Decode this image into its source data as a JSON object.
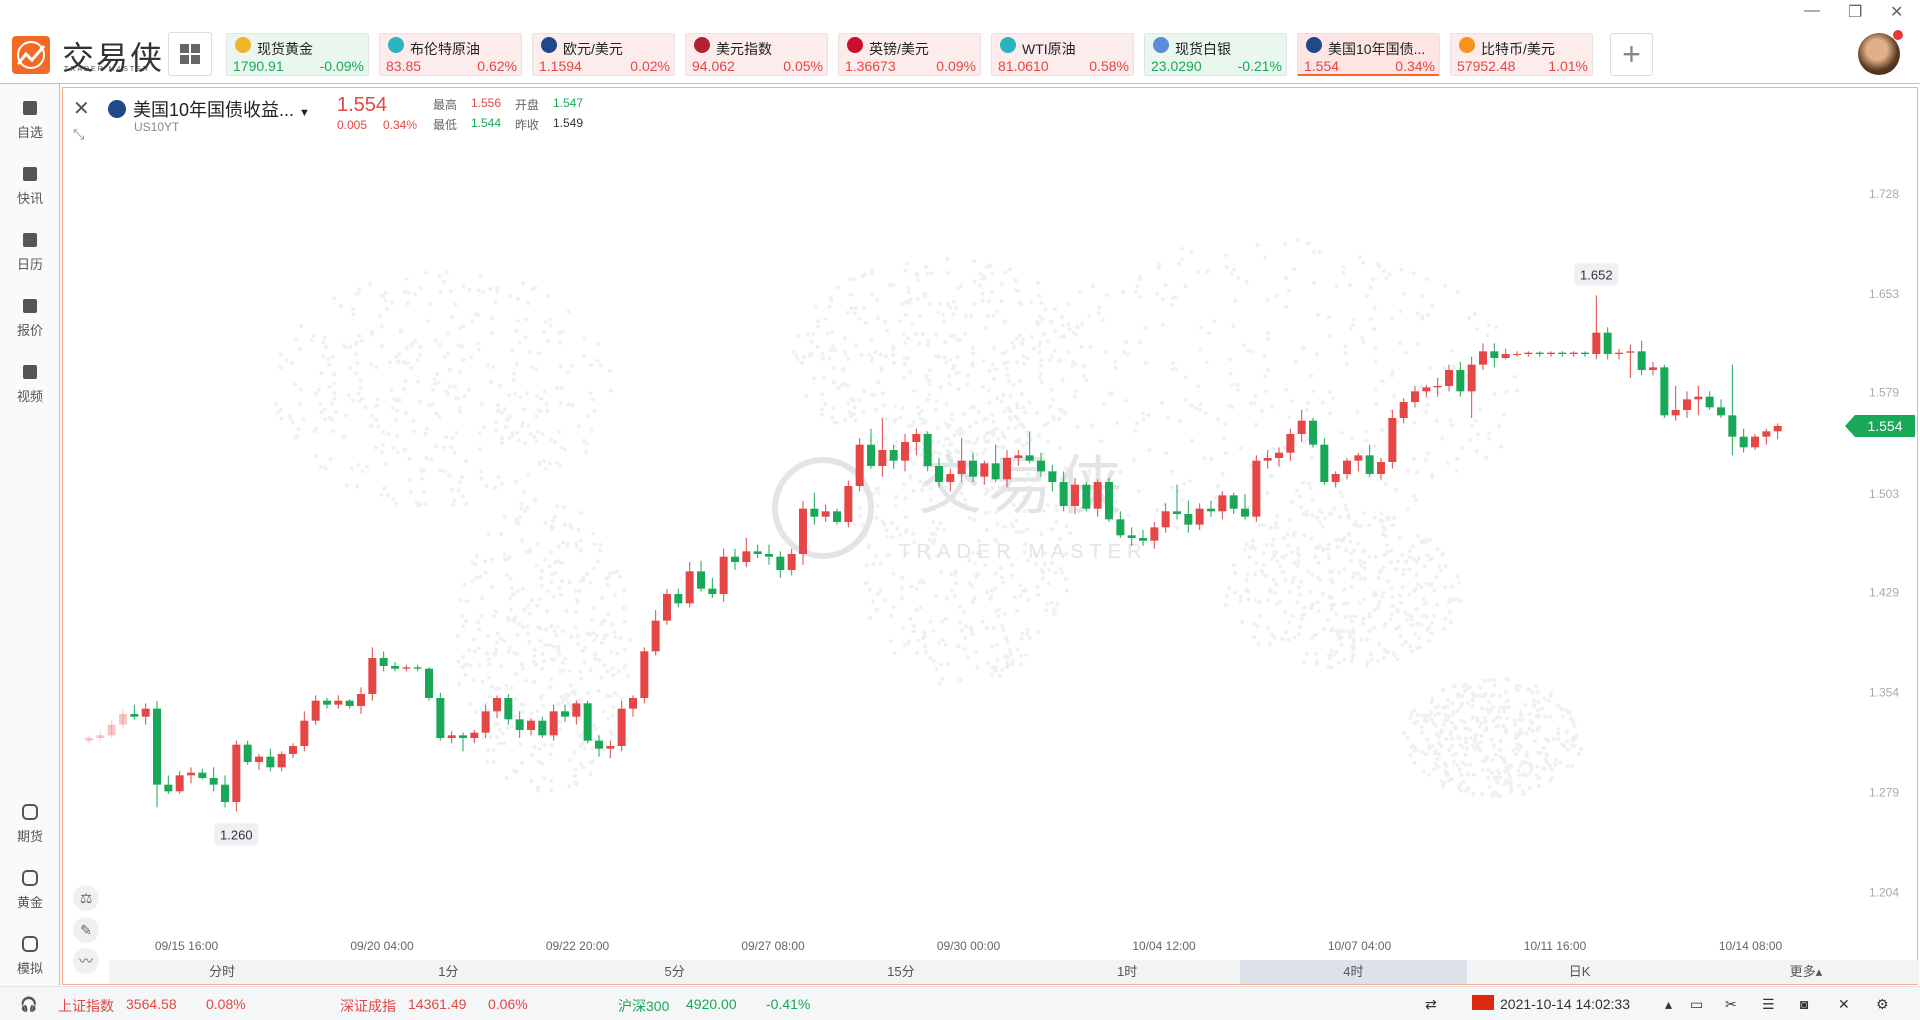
{
  "header": {
    "logo_text": "交易侠",
    "logo_sub": "TRADER MASTER",
    "tiles": [
      {
        "name": "现货黄金",
        "price": "1790.91",
        "pct": "-0.09%",
        "dir": "down",
        "icon_color": "#f0b429",
        "icon": "gold-icon"
      },
      {
        "name": "布伦特原油",
        "price": "83.85",
        "pct": "0.62%",
        "dir": "up",
        "icon_color": "#2bb3c0",
        "icon": "oil-icon"
      },
      {
        "name": "欧元/美元",
        "price": "1.1594",
        "pct": "0.02%",
        "dir": "up",
        "icon_color": "#1f4a8a",
        "icon": "eu-flag-icon"
      },
      {
        "name": "美元指数",
        "price": "94.062",
        "pct": "0.05%",
        "dir": "up",
        "icon_color": "#b22234",
        "icon": "us-flag-icon"
      },
      {
        "name": "英镑/美元",
        "price": "1.36673",
        "pct": "0.09%",
        "dir": "up",
        "icon_color": "#c8102e",
        "icon": "uk-flag-icon"
      },
      {
        "name": "WTI原油",
        "price": "81.0610",
        "pct": "0.58%",
        "dir": "up",
        "icon_color": "#2bb3c0",
        "icon": "oil-icon"
      },
      {
        "name": "现货白银",
        "price": "23.0290",
        "pct": "-0.21%",
        "dir": "down",
        "icon_color": "#5b8bd9",
        "icon": "silver-icon"
      },
      {
        "name": "美国10年国债...",
        "price": "1.554",
        "pct": "0.34%",
        "dir": "up",
        "icon_color": "#1f4a8a",
        "icon": "bond-icon",
        "active": true
      },
      {
        "name": "比特币/美元",
        "price": "57952.48",
        "pct": "1.01%",
        "dir": "up",
        "icon_color": "#f7931a",
        "icon": "bitcoin-icon"
      }
    ]
  },
  "sidebar": {
    "top": [
      {
        "label": "自选",
        "icon": "bookmark-plus-icon"
      },
      {
        "label": "快讯",
        "icon": "news-icon"
      },
      {
        "label": "日历",
        "icon": "calendar-icon"
      },
      {
        "label": "报价",
        "icon": "chart-line-icon"
      },
      {
        "label": "视频",
        "icon": "video-icon"
      }
    ],
    "bottom": [
      {
        "label": "期货",
        "icon": "futures-icon"
      },
      {
        "label": "黄金",
        "icon": "gold-bar-icon"
      },
      {
        "label": "模拟",
        "icon": "simulate-icon"
      }
    ]
  },
  "symbol": {
    "name": "美国10年国债收益...",
    "code": "US10YT",
    "price": "1.554",
    "change": "0.005",
    "pct": "0.34%",
    "high_label": "最高",
    "high": "1.556",
    "low_label": "最低",
    "low": "1.544",
    "open_label": "开盘",
    "open": "1.547",
    "prev_label": "昨收",
    "prev": "1.549"
  },
  "timeframes": [
    "分时",
    "1分",
    "5分",
    "15分",
    "1时",
    "4时",
    "日K",
    "更多▴"
  ],
  "active_timeframe": "4时",
  "statusbar": {
    "items": [
      {
        "name": "上证指数",
        "value": "3564.58",
        "pct": "0.08%",
        "dir": "up"
      },
      {
        "name": "深证成指",
        "value": "14361.49",
        "pct": "0.06%",
        "dir": "up"
      },
      {
        "name": "沪深300",
        "value": "4920.00",
        "pct": "-0.41%",
        "dir": "down"
      }
    ],
    "datetime": "2021-10-14 14:02:33"
  },
  "watermark": {
    "text": "交易侠",
    "sub": "TRADER MASTER"
  },
  "chart_data": {
    "type": "candlestick",
    "y_ticks": [
      1.204,
      1.279,
      1.354,
      1.429,
      1.503,
      1.579,
      1.653,
      1.728
    ],
    "ylim": [
      1.17,
      1.77
    ],
    "x_tick_labels": [
      "09/15 16:00",
      "09/20 04:00",
      "09/22 20:00",
      "09/27 08:00",
      "09/30 00:00",
      "10/04 12:00",
      "10/07 04:00",
      "10/11 16:00",
      "10/14 08:00"
    ],
    "current_price_label": "1.554",
    "max_label": "1.652",
    "min_label": "1.260",
    "candles": [
      [
        1.318,
        1.322,
        1.316,
        1.32
      ],
      [
        1.32,
        1.325,
        1.318,
        1.322
      ],
      [
        1.322,
        1.333,
        1.32,
        1.33
      ],
      [
        1.33,
        1.342,
        1.327,
        1.338
      ],
      [
        1.338,
        1.345,
        1.334,
        1.336
      ],
      [
        1.336,
        1.346,
        1.33,
        1.342
      ],
      [
        1.342,
        1.348,
        1.268,
        1.285
      ],
      [
        1.285,
        1.292,
        1.278,
        1.28
      ],
      [
        1.28,
        1.295,
        1.278,
        1.292
      ],
      [
        1.292,
        1.298,
        1.286,
        1.294
      ],
      [
        1.294,
        1.297,
        1.289,
        1.29
      ],
      [
        1.29,
        1.298,
        1.28,
        1.285
      ],
      [
        1.285,
        1.292,
        1.268,
        1.272
      ],
      [
        1.272,
        1.318,
        1.265,
        1.315
      ],
      [
        1.315,
        1.318,
        1.3,
        1.302
      ],
      [
        1.302,
        1.308,
        1.296,
        1.306
      ],
      [
        1.306,
        1.312,
        1.295,
        1.298
      ],
      [
        1.298,
        1.31,
        1.295,
        1.308
      ],
      [
        1.308,
        1.316,
        1.305,
        1.314
      ],
      [
        1.314,
        1.34,
        1.31,
        1.333
      ],
      [
        1.333,
        1.352,
        1.33,
        1.348
      ],
      [
        1.348,
        1.35,
        1.342,
        1.345
      ],
      [
        1.345,
        1.352,
        1.342,
        1.348
      ],
      [
        1.348,
        1.349,
        1.342,
        1.344
      ],
      [
        1.344,
        1.358,
        1.338,
        1.353
      ],
      [
        1.353,
        1.388,
        1.348,
        1.38
      ],
      [
        1.38,
        1.385,
        1.37,
        1.374
      ],
      [
        1.374,
        1.377,
        1.37,
        1.372
      ],
      [
        1.372,
        1.375,
        1.37,
        1.373
      ],
      [
        1.373,
        1.375,
        1.37,
        1.372
      ],
      [
        1.372,
        1.373,
        1.348,
        1.35
      ],
      [
        1.35,
        1.354,
        1.318,
        1.32
      ],
      [
        1.32,
        1.325,
        1.316,
        1.322
      ],
      [
        1.322,
        1.324,
        1.31,
        1.32
      ],
      [
        1.32,
        1.326,
        1.316,
        1.324
      ],
      [
        1.324,
        1.345,
        1.32,
        1.34
      ],
      [
        1.34,
        1.352,
        1.335,
        1.35
      ],
      [
        1.35,
        1.353,
        1.33,
        1.334
      ],
      [
        1.334,
        1.34,
        1.32,
        1.326
      ],
      [
        1.326,
        1.335,
        1.322,
        1.333
      ],
      [
        1.333,
        1.336,
        1.32,
        1.322
      ],
      [
        1.322,
        1.345,
        1.318,
        1.34
      ],
      [
        1.34,
        1.345,
        1.332,
        1.336
      ],
      [
        1.336,
        1.348,
        1.33,
        1.346
      ],
      [
        1.346,
        1.348,
        1.316,
        1.318
      ],
      [
        1.318,
        1.322,
        1.306,
        1.312
      ],
      [
        1.312,
        1.318,
        1.305,
        1.314
      ],
      [
        1.314,
        1.348,
        1.31,
        1.342
      ],
      [
        1.342,
        1.352,
        1.336,
        1.35
      ],
      [
        1.35,
        1.388,
        1.346,
        1.385
      ],
      [
        1.385,
        1.416,
        1.382,
        1.408
      ],
      [
        1.408,
        1.432,
        1.405,
        1.428
      ],
      [
        1.428,
        1.432,
        1.418,
        1.421
      ],
      [
        1.421,
        1.452,
        1.418,
        1.445
      ],
      [
        1.445,
        1.453,
        1.43,
        1.432
      ],
      [
        1.432,
        1.44,
        1.425,
        1.428
      ],
      [
        1.428,
        1.462,
        1.422,
        1.456
      ],
      [
        1.456,
        1.462,
        1.446,
        1.452
      ],
      [
        1.452,
        1.47,
        1.448,
        1.46
      ],
      [
        1.46,
        1.465,
        1.455,
        1.458
      ],
      [
        1.458,
        1.465,
        1.45,
        1.456
      ],
      [
        1.456,
        1.46,
        1.44,
        1.446
      ],
      [
        1.446,
        1.462,
        1.442,
        1.458
      ],
      [
        1.458,
        1.498,
        1.45,
        1.492
      ],
      [
        1.492,
        1.504,
        1.48,
        1.486
      ],
      [
        1.486,
        1.495,
        1.482,
        1.49
      ],
      [
        1.49,
        1.492,
        1.48,
        1.482
      ],
      [
        1.482,
        1.513,
        1.478,
        1.509
      ],
      [
        1.509,
        1.545,
        1.505,
        1.54
      ],
      [
        1.54,
        1.552,
        1.522,
        1.524
      ],
      [
        1.524,
        1.56,
        1.516,
        1.536
      ],
      [
        1.536,
        1.54,
        1.522,
        1.528
      ],
      [
        1.528,
        1.548,
        1.52,
        1.542
      ],
      [
        1.542,
        1.552,
        1.532,
        1.548
      ],
      [
        1.548,
        1.55,
        1.52,
        1.524
      ],
      [
        1.524,
        1.53,
        1.508,
        1.512
      ],
      [
        1.512,
        1.522,
        1.505,
        1.518
      ],
      [
        1.518,
        1.545,
        1.512,
        1.528
      ],
      [
        1.528,
        1.534,
        1.512,
        1.516
      ],
      [
        1.516,
        1.528,
        1.51,
        1.526
      ],
      [
        1.526,
        1.54,
        1.512,
        1.514
      ],
      [
        1.514,
        1.536,
        1.508,
        1.53
      ],
      [
        1.53,
        1.536,
        1.524,
        1.532
      ],
      [
        1.532,
        1.55,
        1.526,
        1.528
      ],
      [
        1.528,
        1.534,
        1.516,
        1.52
      ],
      [
        1.52,
        1.525,
        1.505,
        1.512
      ],
      [
        1.512,
        1.52,
        1.49,
        1.494
      ],
      [
        1.494,
        1.515,
        1.488,
        1.51
      ],
      [
        1.51,
        1.512,
        1.49,
        1.492
      ],
      [
        1.492,
        1.514,
        1.486,
        1.512
      ],
      [
        1.512,
        1.515,
        1.482,
        1.484
      ],
      [
        1.484,
        1.49,
        1.47,
        1.472
      ],
      [
        1.472,
        1.478,
        1.464,
        1.47
      ],
      [
        1.47,
        1.476,
        1.464,
        1.468
      ],
      [
        1.468,
        1.482,
        1.462,
        1.478
      ],
      [
        1.478,
        1.496,
        1.474,
        1.49
      ],
      [
        1.49,
        1.51,
        1.484,
        1.488
      ],
      [
        1.488,
        1.498,
        1.474,
        1.48
      ],
      [
        1.48,
        1.496,
        1.476,
        1.492
      ],
      [
        1.492,
        1.498,
        1.486,
        1.49
      ],
      [
        1.49,
        1.505,
        1.484,
        1.502
      ],
      [
        1.502,
        1.504,
        1.488,
        1.492
      ],
      [
        1.492,
        1.503,
        1.484,
        1.486
      ],
      [
        1.486,
        1.532,
        1.482,
        1.528
      ],
      [
        1.528,
        1.536,
        1.522,
        1.53
      ],
      [
        1.53,
        1.538,
        1.524,
        1.534
      ],
      [
        1.534,
        1.552,
        1.528,
        1.548
      ],
      [
        1.548,
        1.566,
        1.542,
        1.558
      ],
      [
        1.558,
        1.56,
        1.538,
        1.54
      ],
      [
        1.54,
        1.545,
        1.51,
        1.512
      ],
      [
        1.512,
        1.52,
        1.508,
        1.518
      ],
      [
        1.518,
        1.53,
        1.514,
        1.528
      ],
      [
        1.528,
        1.534,
        1.52,
        1.532
      ],
      [
        1.532,
        1.54,
        1.516,
        1.518
      ],
      [
        1.518,
        1.53,
        1.514,
        1.527
      ],
      [
        1.527,
        1.566,
        1.522,
        1.56
      ],
      [
        1.56,
        1.575,
        1.556,
        1.572
      ],
      [
        1.572,
        1.584,
        1.568,
        1.58
      ],
      [
        1.58,
        1.585,
        1.576,
        1.583
      ],
      [
        1.583,
        1.59,
        1.576,
        1.584
      ],
      [
        1.584,
        1.6,
        1.58,
        1.596
      ],
      [
        1.596,
        1.602,
        1.576,
        1.58
      ],
      [
        1.58,
        1.606,
        1.56,
        1.6
      ],
      [
        1.6,
        1.616,
        1.596,
        1.61
      ],
      [
        1.61,
        1.616,
        1.598,
        1.605
      ],
      [
        1.605,
        1.612,
        1.604,
        1.608
      ],
      [
        1.608,
        1.61,
        1.606,
        1.608
      ],
      [
        1.608,
        1.61,
        1.606,
        1.609
      ],
      [
        1.609,
        1.61,
        1.606,
        1.608
      ],
      [
        1.608,
        1.61,
        1.606,
        1.609
      ],
      [
        1.609,
        1.61,
        1.606,
        1.608
      ],
      [
        1.608,
        1.61,
        1.606,
        1.609
      ],
      [
        1.609,
        1.61,
        1.606,
        1.608
      ],
      [
        1.608,
        1.652,
        1.604,
        1.624
      ],
      [
        1.624,
        1.628,
        1.604,
        1.608
      ],
      [
        1.608,
        1.612,
        1.604,
        1.609
      ],
      [
        1.609,
        1.615,
        1.59,
        1.61
      ],
      [
        1.61,
        1.618,
        1.592,
        1.596
      ],
      [
        1.596,
        1.602,
        1.592,
        1.598
      ],
      [
        1.598,
        1.6,
        1.56,
        1.562
      ],
      [
        1.562,
        1.584,
        1.558,
        1.566
      ],
      [
        1.566,
        1.58,
        1.56,
        1.574
      ],
      [
        1.574,
        1.584,
        1.562,
        1.576
      ],
      [
        1.576,
        1.58,
        1.566,
        1.568
      ],
      [
        1.568,
        1.574,
        1.56,
        1.562
      ],
      [
        1.562,
        1.6,
        1.532,
        1.546
      ],
      [
        1.546,
        1.552,
        1.534,
        1.538
      ],
      [
        1.538,
        1.548,
        1.536,
        1.546
      ],
      [
        1.546,
        1.552,
        1.54,
        1.55
      ],
      [
        1.55,
        1.556,
        1.544,
        1.554
      ]
    ]
  }
}
